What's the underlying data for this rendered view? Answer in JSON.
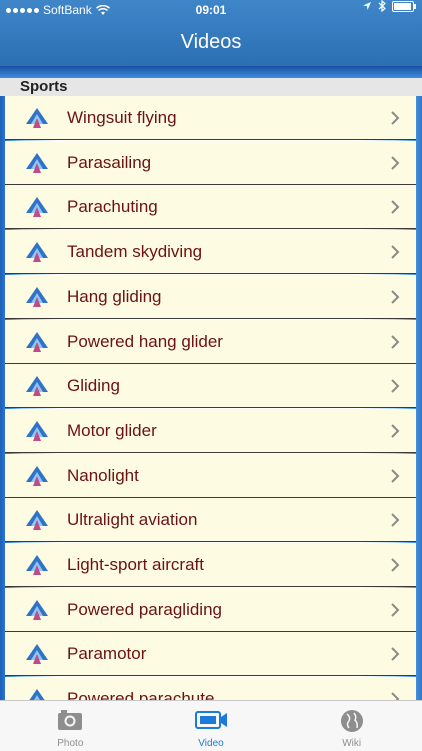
{
  "status": {
    "carrier": "SoftBank",
    "time": "09:01"
  },
  "nav": {
    "title": "Videos"
  },
  "section": {
    "title": "Sports"
  },
  "items": [
    {
      "label": "Wingsuit flying"
    },
    {
      "label": "Parasailing"
    },
    {
      "label": "Parachuting"
    },
    {
      "label": "Tandem skydiving"
    },
    {
      "label": "Hang gliding"
    },
    {
      "label": "Powered hang glider"
    },
    {
      "label": "Gliding"
    },
    {
      "label": "Motor glider"
    },
    {
      "label": "Nanolight"
    },
    {
      "label": "Ultralight aviation"
    },
    {
      "label": "Light-sport aircraft"
    },
    {
      "label": "Powered paragliding"
    },
    {
      "label": "Paramotor"
    },
    {
      "label": "Powered parachute"
    }
  ],
  "tabs": [
    {
      "label": "Photo",
      "icon": "camera-icon",
      "active": false
    },
    {
      "label": "Video",
      "icon": "video-camera-icon",
      "active": true
    },
    {
      "label": "Wiki",
      "icon": "globe-icon",
      "active": false
    }
  ],
  "colors": {
    "nav_bar": "#2c6fb3",
    "row_background": "#fdfbe1",
    "row_text": "#6b1212",
    "tab_active": "#1e7ad8"
  }
}
